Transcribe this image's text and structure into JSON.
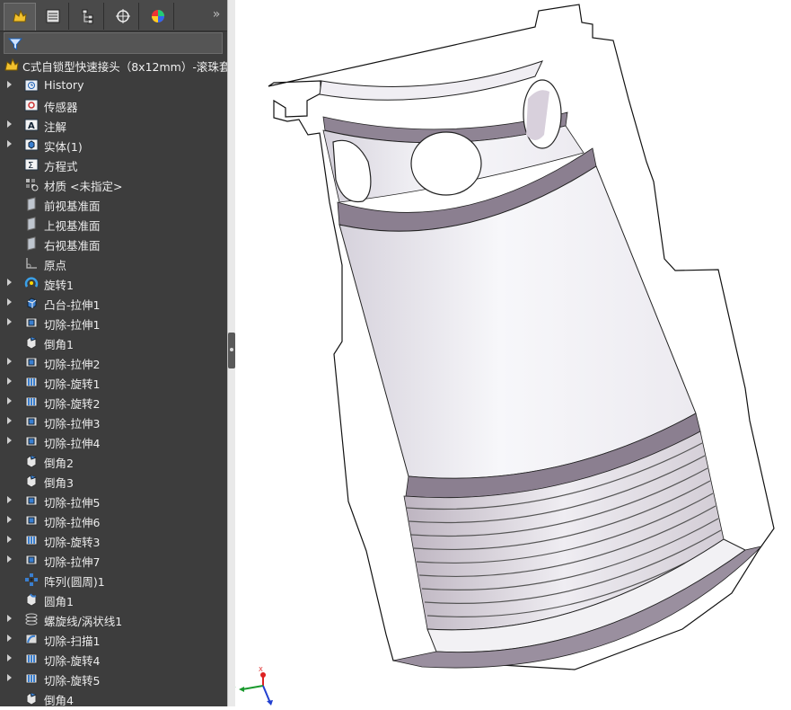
{
  "tabs": [
    {
      "name": "featuremanager-icon"
    },
    {
      "name": "propertymanager-icon"
    },
    {
      "name": "configurationmanager-icon"
    },
    {
      "name": "dimxpert-icon"
    },
    {
      "name": "display-manager-icon"
    }
  ],
  "filter": {
    "icon": "filter-icon"
  },
  "root": {
    "label": "C式自锁型快速接头（8x12mm）-滚珠套",
    "icon": "part-icon"
  },
  "tree": [
    {
      "label": "History",
      "icon": "history-icon",
      "expand": true
    },
    {
      "label": "传感器",
      "icon": "sensor-icon",
      "expand": false
    },
    {
      "label": "注解",
      "icon": "annotation-icon",
      "expand": true
    },
    {
      "label": "实体(1)",
      "icon": "solid-body-icon",
      "expand": true
    },
    {
      "label": "方程式",
      "icon": "equation-icon",
      "expand": false
    },
    {
      "label": "材质 <未指定>",
      "icon": "material-icon",
      "expand": false
    },
    {
      "label": "前视基准面",
      "icon": "plane-icon",
      "expand": false
    },
    {
      "label": "上视基准面",
      "icon": "plane-icon",
      "expand": false
    },
    {
      "label": "右视基准面",
      "icon": "plane-icon",
      "expand": false
    },
    {
      "label": "原点",
      "icon": "origin-icon",
      "expand": false
    },
    {
      "label": "旋转1",
      "icon": "revolve-icon",
      "expand": true
    },
    {
      "label": "凸台-拉伸1",
      "icon": "boss-extrude-icon",
      "expand": true
    },
    {
      "label": "切除-拉伸1",
      "icon": "cut-extrude-icon",
      "expand": true
    },
    {
      "label": "倒角1",
      "icon": "chamfer-icon",
      "expand": false
    },
    {
      "label": "切除-拉伸2",
      "icon": "cut-extrude-icon",
      "expand": true
    },
    {
      "label": "切除-旋转1",
      "icon": "cut-revolve-icon",
      "expand": true
    },
    {
      "label": "切除-旋转2",
      "icon": "cut-revolve-icon",
      "expand": true
    },
    {
      "label": "切除-拉伸3",
      "icon": "cut-extrude-icon",
      "expand": true
    },
    {
      "label": "切除-拉伸4",
      "icon": "cut-extrude-icon",
      "expand": true
    },
    {
      "label": "倒角2",
      "icon": "chamfer-icon",
      "expand": false
    },
    {
      "label": "倒角3",
      "icon": "chamfer-icon",
      "expand": false
    },
    {
      "label": "切除-拉伸5",
      "icon": "cut-extrude-icon",
      "expand": true
    },
    {
      "label": "切除-拉伸6",
      "icon": "cut-extrude-icon",
      "expand": true
    },
    {
      "label": "切除-旋转3",
      "icon": "cut-revolve-icon",
      "expand": true
    },
    {
      "label": "切除-拉伸7",
      "icon": "cut-extrude-icon",
      "expand": true
    },
    {
      "label": "阵列(圆周)1",
      "icon": "circular-pattern-icon",
      "expand": false
    },
    {
      "label": "圆角1",
      "icon": "fillet-icon",
      "expand": false
    },
    {
      "label": "螺旋线/涡状线1",
      "icon": "helix-icon",
      "expand": true
    },
    {
      "label": "切除-扫描1",
      "icon": "cut-sweep-icon",
      "expand": true
    },
    {
      "label": "切除-旋转4",
      "icon": "cut-revolve-icon",
      "expand": true
    },
    {
      "label": "切除-旋转5",
      "icon": "cut-revolve-icon",
      "expand": true
    },
    {
      "label": "倒角4",
      "icon": "chamfer-icon",
      "expand": false
    }
  ],
  "triad": {
    "y": "Y",
    "x": "X"
  },
  "colors": {
    "panel": "#3d3d3d",
    "viewport": "#ffffff",
    "part_fill": "#f2f2f6",
    "part_shade": "#a89aa8"
  }
}
